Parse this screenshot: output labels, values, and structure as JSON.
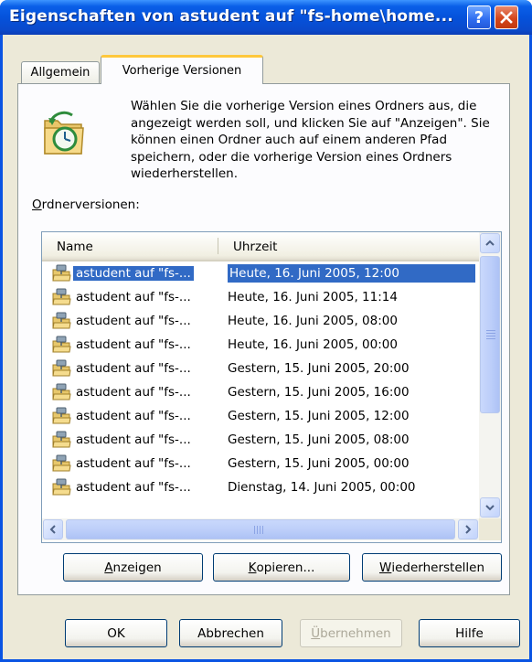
{
  "window": {
    "title": "Eigenschaften von astudent auf \"fs-home\\home...",
    "help_glyph": "?"
  },
  "tabs": [
    {
      "label": "Allgemein",
      "active": false
    },
    {
      "label": "Vorherige Versionen",
      "active": true
    }
  ],
  "panel": {
    "description": "Wählen Sie die vorherige Version eines Ordners aus, die angezeigt werden soll, und klicken Sie auf \"Anzeigen\". Sie können einen Ordner auch auf einem anderen Pfad speichern, oder die vorherige Version eines Ordners wiederherstellen.",
    "list_label_first": "O",
    "list_label_rest": "rdnerversionen:",
    "icon": "folder-clock-icon"
  },
  "list": {
    "columns": [
      "Name",
      "Uhrzeit"
    ],
    "rows": [
      {
        "name": "astudent auf \"fs-...",
        "time": "Heute, 16. Juni 2005, 12:00",
        "selected": true
      },
      {
        "name": "astudent auf \"fs-...",
        "time": "Heute, 16. Juni 2005, 11:14",
        "selected": false
      },
      {
        "name": "astudent auf \"fs-...",
        "time": "Heute, 16. Juni 2005, 08:00",
        "selected": false
      },
      {
        "name": "astudent auf \"fs-...",
        "time": "Heute, 16. Juni 2005, 00:00",
        "selected": false
      },
      {
        "name": "astudent auf \"fs-...",
        "time": "Gestern, 15. Juni 2005, 20:00",
        "selected": false
      },
      {
        "name": "astudent auf \"fs-...",
        "time": "Gestern, 15. Juni 2005, 16:00",
        "selected": false
      },
      {
        "name": "astudent auf \"fs-...",
        "time": "Gestern, 15. Juni 2005, 12:00",
        "selected": false
      },
      {
        "name": "astudent auf \"fs-...",
        "time": "Gestern, 15. Juni 2005, 08:00",
        "selected": false
      },
      {
        "name": "astudent auf \"fs-...",
        "time": "Gestern, 15. Juni 2005, 00:00",
        "selected": false
      },
      {
        "name": "astudent auf \"fs-...",
        "time": "Dienstag, 14. Juni 2005, 00:00",
        "selected": false
      }
    ]
  },
  "actions": {
    "show": {
      "mnemonic": "A",
      "rest": "nzeigen"
    },
    "copy": {
      "mnemonic": "K",
      "rest": "opieren..."
    },
    "restore": {
      "mnemonic": "W",
      "rest": "iederherstellen"
    }
  },
  "footer": {
    "ok": "OK",
    "cancel": "Abbrechen",
    "apply_mnemonic": "Ü",
    "apply_rest": "bernehmen",
    "help": "Hilfe"
  },
  "colors": {
    "selection": "#316AC5",
    "titlebar": "#0552DB",
    "dialog_bg": "#ECE9D8",
    "tab_accent": "#FFC83C"
  }
}
